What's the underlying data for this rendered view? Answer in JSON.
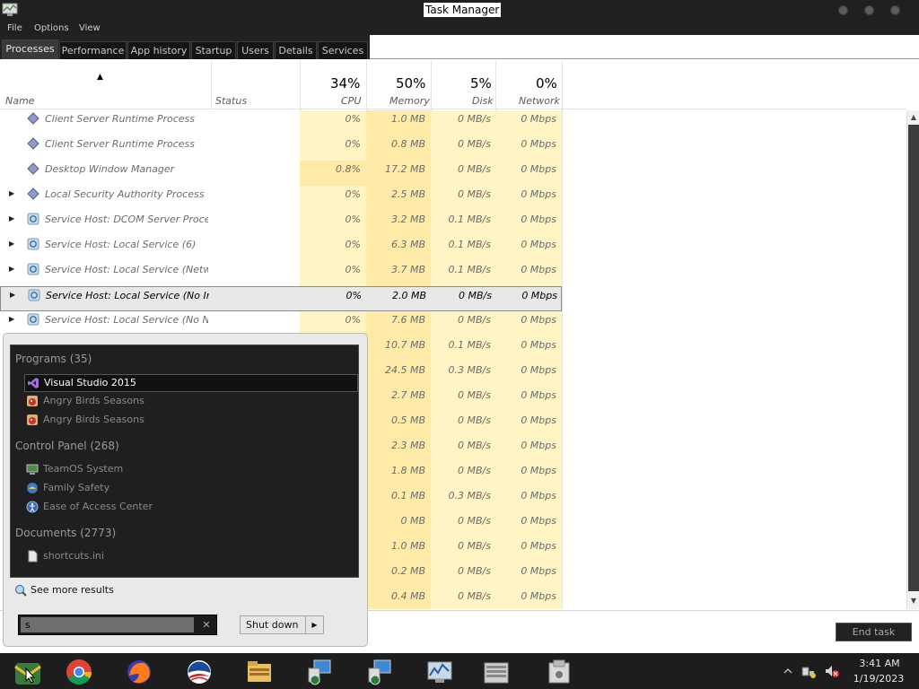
{
  "window": {
    "title": "Task Manager"
  },
  "menu": [
    "File",
    "Options",
    "View"
  ],
  "tabs": [
    "Processes",
    "Performance",
    "App history",
    "Startup",
    "Users",
    "Details",
    "Services"
  ],
  "columns": {
    "name": "Name",
    "status": "Status",
    "cpu": {
      "label": "CPU",
      "percent": "34%"
    },
    "memory": {
      "label": "Memory",
      "percent": "50%"
    },
    "disk": {
      "label": "Disk",
      "percent": "5%"
    },
    "network": {
      "label": "Network",
      "percent": "0%"
    }
  },
  "processes": [
    {
      "name": "Client Server Runtime Process",
      "cpu": "0%",
      "memory": "1.0 MB",
      "disk": "0 MB/s",
      "network": "0 Mbps",
      "expandable": false,
      "icon": "diamond-icon"
    },
    {
      "name": "Client Server Runtime Process",
      "cpu": "0%",
      "memory": "0.8 MB",
      "disk": "0 MB/s",
      "network": "0 Mbps",
      "expandable": false,
      "icon": "diamond-icon"
    },
    {
      "name": "Desktop Window Manager",
      "cpu": "0.8%",
      "memory": "17.2 MB",
      "disk": "0 MB/s",
      "network": "0 Mbps",
      "expandable": false,
      "icon": "diamond-icon"
    },
    {
      "name": "Local Security Authority Process",
      "cpu": "0%",
      "memory": "2.5 MB",
      "disk": "0 MB/s",
      "network": "0 Mbps",
      "expandable": true,
      "icon": "diamond-icon"
    },
    {
      "name": "Service Host: DCOM Server Proces...",
      "cpu": "0%",
      "memory": "3.2 MB",
      "disk": "0.1 MB/s",
      "network": "0 Mbps",
      "expandable": true,
      "icon": "gear-icon"
    },
    {
      "name": "Service Host: Local Service (6)",
      "cpu": "0%",
      "memory": "6.3 MB",
      "disk": "0.1 MB/s",
      "network": "0 Mbps",
      "expandable": true,
      "icon": "gear-icon"
    },
    {
      "name": "Service Host: Local Service (Netw...",
      "cpu": "0%",
      "memory": "3.7 MB",
      "disk": "0.1 MB/s",
      "network": "0 Mbps",
      "expandable": true,
      "icon": "gear-icon"
    },
    {
      "name": "Service Host: Local Service (No Im...",
      "cpu": "0%",
      "memory": "2.0 MB",
      "disk": "0 MB/s",
      "network": "0 Mbps",
      "expandable": true,
      "icon": "gear-icon",
      "selected": true
    },
    {
      "name": "Service Host: Local Service (No N...",
      "cpu": "0%",
      "memory": "7.6 MB",
      "disk": "0 MB/s",
      "network": "0 Mbps",
      "expandable": true,
      "icon": "gear-icon"
    },
    {
      "name": "",
      "cpu": "",
      "memory": "10.7 MB",
      "disk": "0.1 MB/s",
      "network": "0 Mbps"
    },
    {
      "name": "",
      "cpu": "",
      "memory": "24.5 MB",
      "disk": "0.3 MB/s",
      "network": "0 Mbps"
    },
    {
      "name": "",
      "cpu": "",
      "memory": "2.7 MB",
      "disk": "0 MB/s",
      "network": "0 Mbps"
    },
    {
      "name": "",
      "cpu": "",
      "memory": "0.5 MB",
      "disk": "0 MB/s",
      "network": "0 Mbps"
    },
    {
      "name": "",
      "cpu": "",
      "memory": "2.3 MB",
      "disk": "0 MB/s",
      "network": "0 Mbps"
    },
    {
      "name": "",
      "cpu": "",
      "memory": "1.8 MB",
      "disk": "0 MB/s",
      "network": "0 Mbps"
    },
    {
      "name": "",
      "cpu": "",
      "memory": "0.1 MB",
      "disk": "0.3 MB/s",
      "network": "0 Mbps"
    },
    {
      "name": "",
      "cpu": "",
      "memory": "0 MB",
      "disk": "0 MB/s",
      "network": "0 Mbps"
    },
    {
      "name": "",
      "cpu": "",
      "memory": "1.0 MB",
      "disk": "0 MB/s",
      "network": "0 Mbps"
    },
    {
      "name": "",
      "cpu": "",
      "memory": "0.2 MB",
      "disk": "0 MB/s",
      "network": "0 Mbps"
    },
    {
      "name": "",
      "cpu": "",
      "memory": "0.4 MB",
      "disk": "0 MB/s",
      "network": "0 Mbps"
    }
  ],
  "footer": {
    "end_task": "End task"
  },
  "start_menu": {
    "groups": [
      {
        "title": "Programs (35)",
        "items": [
          {
            "label": "Visual Studio 2015",
            "icon": "visual-studio-icon",
            "highlighted": true
          },
          {
            "label": "Angry Birds Seasons",
            "icon": "angry-birds-icon"
          },
          {
            "label": "Angry Birds Seasons",
            "icon": "angry-birds-icon"
          }
        ]
      },
      {
        "title": "Control Panel (268)",
        "items": [
          {
            "label": "TeamOS System",
            "icon": "monitor-icon"
          },
          {
            "label": "Family Safety",
            "icon": "family-safety-icon"
          },
          {
            "label": "Ease of Access Center",
            "icon": "ease-of-access-icon"
          }
        ]
      },
      {
        "title": "Documents (2773)",
        "items": [
          {
            "label": "shortcuts.ini",
            "icon": "file-icon"
          }
        ]
      }
    ],
    "see_more": "See more results",
    "search_value": "s",
    "shutdown": "Shut down"
  },
  "taskbar": {
    "apps": [
      "start-orb-icon",
      "chrome-icon",
      "firefox-icon",
      "obama-logo-icon",
      "file-explorer-icon",
      "network-setup-icon",
      "network-setup-icon",
      "performance-monitor-icon",
      "server-icon",
      "drive-icon"
    ],
    "clock": {
      "time": "3:41 AM",
      "date": "1/19/2023"
    }
  },
  "colors": {
    "titlebar": "#202020",
    "cpu_column": "#fff4c4",
    "cpu_column_high": "#ffeaa8",
    "memory_column": "#ffeaa8",
    "disk_column": "#fff4c4",
    "network_column": "#fff4c4"
  }
}
